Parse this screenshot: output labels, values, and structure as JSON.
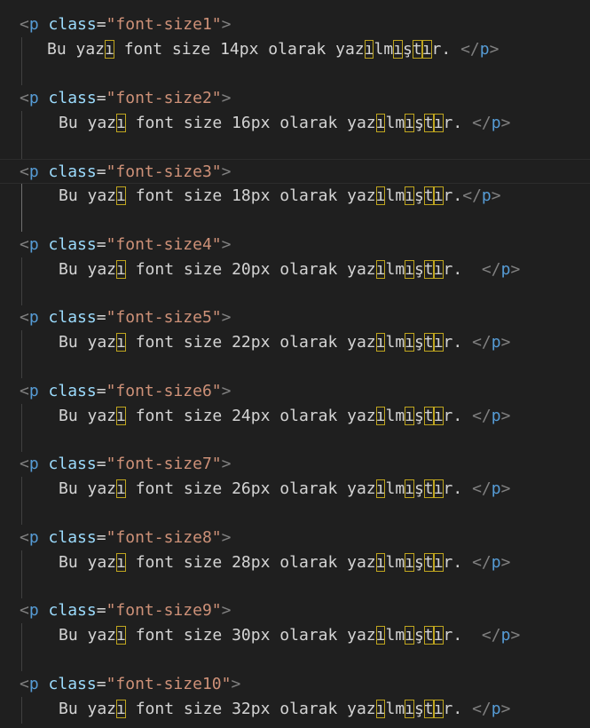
{
  "editor": {
    "blocks": [
      {
        "open": {
          "tag": "p",
          "attr": "class",
          "value": "font-size1"
        },
        "text": [
          "Bu yaz",
          "ı",
          " font size 14px olarak yaz",
          "ı",
          "lm",
          "ı",
          "ş",
          "t",
          "ı",
          "r. "
        ],
        "close": "/p"
      },
      {
        "open": {
          "tag": "p",
          "attr": "class",
          "value": "font-size2"
        },
        "text": [
          "Bu yaz",
          "ı",
          " font size 16px olarak yaz",
          "ı",
          "lm",
          "ı",
          "ş",
          "t",
          "ı",
          "r. "
        ],
        "close": "/p"
      },
      {
        "open": {
          "tag": "p",
          "attr": "class",
          "value": "font-size3"
        },
        "text": [
          "Bu yaz",
          "ı",
          " font size 18px olarak yaz",
          "ı",
          "lm",
          "ı",
          "ş",
          "t",
          "ı",
          "r."
        ],
        "close": "/p"
      },
      {
        "open": {
          "tag": "p",
          "attr": "class",
          "value": "font-size4"
        },
        "text": [
          "Bu yaz",
          "ı",
          " font size 20px olarak yaz",
          "ı",
          "lm",
          "ı",
          "ş",
          "t",
          "ı",
          "r.  "
        ],
        "close": "/p"
      },
      {
        "open": {
          "tag": "p",
          "attr": "class",
          "value": "font-size5"
        },
        "text": [
          "Bu yaz",
          "ı",
          " font size 22px olarak yaz",
          "ı",
          "lm",
          "ı",
          "ş",
          "t",
          "ı",
          "r. "
        ],
        "close": "/p"
      },
      {
        "open": {
          "tag": "p",
          "attr": "class",
          "value": "font-size6"
        },
        "text": [
          "Bu yaz",
          "ı",
          " font size 24px olarak yaz",
          "ı",
          "lm",
          "ı",
          "ş",
          "t",
          "ı",
          "r. "
        ],
        "close": "/p"
      },
      {
        "open": {
          "tag": "p",
          "attr": "class",
          "value": "font-size7"
        },
        "text": [
          "Bu yaz",
          "ı",
          " font size 26px olarak yaz",
          "ı",
          "lm",
          "ı",
          "ş",
          "t",
          "ı",
          "r. "
        ],
        "close": "/p"
      },
      {
        "open": {
          "tag": "p",
          "attr": "class",
          "value": "font-size8"
        },
        "text": [
          "Bu yaz",
          "ı",
          " font size 28px olarak yaz",
          "ı",
          "lm",
          "ı",
          "ş",
          "t",
          "ı",
          "r. "
        ],
        "close": "/p"
      },
      {
        "open": {
          "tag": "p",
          "attr": "class",
          "value": "font-size9"
        },
        "text": [
          "Bu yaz",
          "ı",
          " font size 30px olarak yaz",
          "ı",
          "lm",
          "ı",
          "ş",
          "t",
          "ı",
          "r.  "
        ],
        "close": "/p"
      },
      {
        "open": {
          "tag": "p",
          "attr": "class",
          "value": "font-size10"
        },
        "text": [
          "Bu yaz",
          "ı",
          " font size 32px olarak yaz",
          "ı",
          "lm",
          "ı",
          "ş",
          "t",
          "ı",
          "r. "
        ],
        "close": "/p"
      }
    ],
    "highlighted_segments": [
      1,
      3,
      5,
      7,
      8
    ],
    "current_line_block": 2
  },
  "colors": {
    "background": "#1f1f1f",
    "tag_bracket": "#808080",
    "tag_name": "#569cd6",
    "attribute_name": "#9cdcfe",
    "attribute_value": "#ce9178",
    "text": "#d4d4d4",
    "unicode_highlight": "#bfa51f"
  }
}
